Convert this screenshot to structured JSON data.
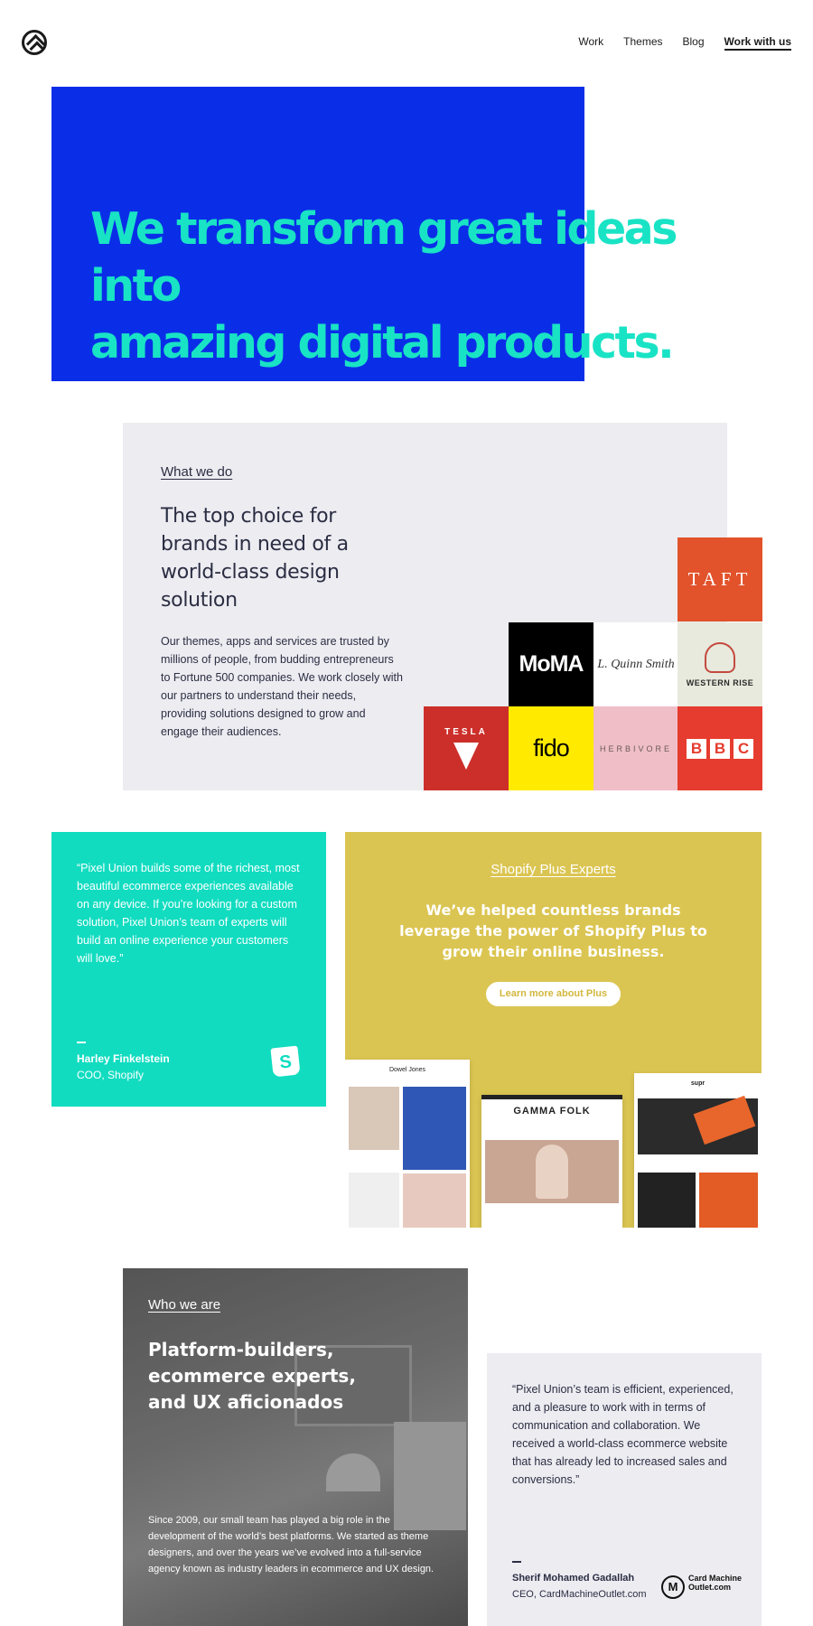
{
  "header": {
    "nav": [
      "Work",
      "Themes",
      "Blog",
      "Work with us"
    ]
  },
  "hero": {
    "title_line1": "We transform great ideas into",
    "title_line2": "amazing digital products."
  },
  "what_we_do": {
    "eyebrow": "What we do",
    "heading": "The top choice for brands in need of a world-class design solution",
    "body": "Our themes, apps and services are trusted by millions of people, from budding entrepreneurs to Fortune 500 companies. We work closely with our partners to understand their needs, providing solutions designed to grow and engage their audiences.",
    "logos": {
      "taft": "TAFT",
      "moma": "MoMA",
      "lqs": "L. Quinn Smith",
      "western_rise": "WESTERN RISE",
      "tesla": "TESLA",
      "fido": "fido",
      "herbivore": "HERBIVORE",
      "bbc": [
        "B",
        "B",
        "C"
      ]
    }
  },
  "testimonial_1": {
    "quote": "“Pixel Union builds some of the richest, most beautiful ecommerce experiences available on any device. If you’re looking for a custom solution, Pixel Union’s team of experts will build an online experience your customers will love.”",
    "name": "Harley Finkelstein",
    "role": "COO, Shopify",
    "icon_letter": "S"
  },
  "shopify_plus": {
    "eyebrow": "Shopify Plus Experts",
    "heading": "We’ve helped countless brands leverage the power of Shopify Plus to grow their online business.",
    "button": "Learn more about Plus",
    "shots": [
      "Dowel Jones",
      "GAMMA FOLK",
      "supr"
    ]
  },
  "who_we_are": {
    "eyebrow": "Who we are",
    "heading": "Platform-builders, ecommerce experts, and UX aficionados",
    "body": "Since 2009, our small team has played a big role in the development of the world’s best platforms. We started as theme designers, and over the years we’ve evolved into a full-service agency known as industry leaders in ecommerce and UX design."
  },
  "testimonial_2": {
    "quote": "“Pixel Union’s team is efficient, experienced, and a pleasure to work with in terms of communication and collaboration. We received a world-class ecommerce website that has already led to increased sales and conversions.”",
    "name": "Sherif Mohamed Gadallah",
    "role": "CEO, CardMachineOutlet.com",
    "logo_mark": "M",
    "logo_text": "Card Machine Outlet.com"
  }
}
